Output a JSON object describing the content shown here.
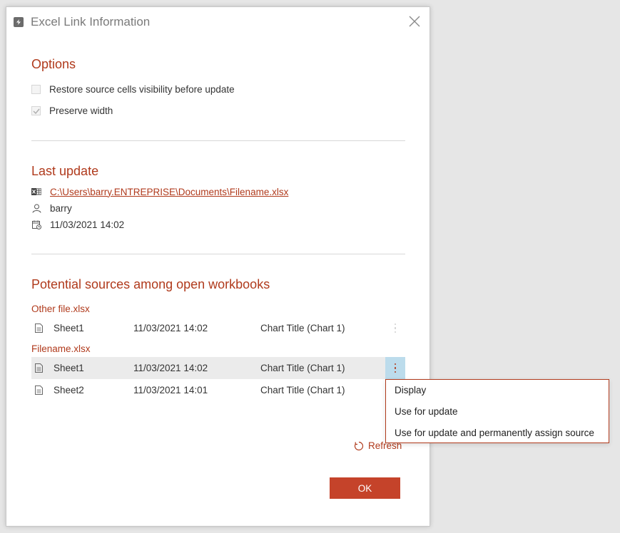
{
  "dialog": {
    "title": "Excel Link Information",
    "app_icon": "excel-link-icon",
    "close_icon": "close-icon"
  },
  "options": {
    "heading": "Options",
    "items": [
      {
        "label": "Restore source cells visibility before update",
        "checked": false
      },
      {
        "label": "Preserve width",
        "checked": true
      }
    ]
  },
  "last_update": {
    "heading": "Last update",
    "file_path": "C:\\Users\\barry.ENTREPRISE\\Documents\\Filename.xlsx",
    "user": "barry",
    "timestamp": "11/03/2021 14:02"
  },
  "sources": {
    "heading": "Potential sources among open workbooks",
    "workbooks": [
      {
        "name": "Other file.xlsx",
        "rows": [
          {
            "sheet": "Sheet1",
            "date": "11/03/2021 14:02",
            "target": "Chart Title (Chart 1)"
          }
        ]
      },
      {
        "name": "Filename.xlsx",
        "rows": [
          {
            "sheet": "Sheet1",
            "date": "11/03/2021 14:02",
            "target": "Chart Title (Chart 1)"
          },
          {
            "sheet": "Sheet2",
            "date": "11/03/2021 14:01",
            "target": "Chart Title (Chart 1)"
          }
        ]
      }
    ]
  },
  "context_menu": {
    "items": [
      "Display",
      "Use for update",
      "Use for update and permanently assign source"
    ]
  },
  "refresh_label": "Refresh",
  "ok_label": "OK",
  "colors": {
    "accent": "#b03a1c",
    "ok_button": "#c5432a",
    "row_highlight": "#ebebeb",
    "kebab_active": "#bcdcec"
  }
}
